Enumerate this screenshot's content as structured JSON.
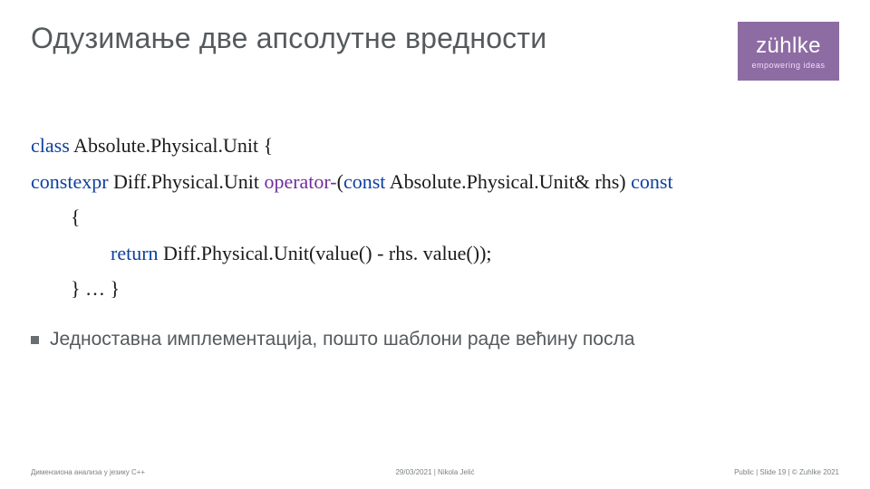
{
  "header": {
    "title": "Одузимање две апсолутне вредности",
    "logo_main": "zühlke",
    "logo_tag": "empowering ideas"
  },
  "code": {
    "l1_kw": "class",
    "l1_rest": " Absolute.Physical.Unit {",
    "l2_kw1": "constexpr",
    "l2_mid": " Diff.Physical.Unit ",
    "l2_op": "operator-",
    "l2_paren": "(",
    "l2_kw2": "const",
    "l2_rest": " Absolute.Physical.Unit& rhs) ",
    "l2_kw3": "const",
    "l3": "        {",
    "l4_indent": "                ",
    "l4_kw": "return",
    "l4_rest": " Diff.Physical.Unit(value() - rhs. value());",
    "l5": "        } … }"
  },
  "bullet": {
    "text": "Једноставна имплементација, пошто шаблони раде већину посла"
  },
  "footer": {
    "left": "Димензиона анализа у језику C++",
    "center": "29/03/2021  |  Nikola Jelić",
    "right": "Public | Slide 19 | © Zuhlke 2021"
  }
}
